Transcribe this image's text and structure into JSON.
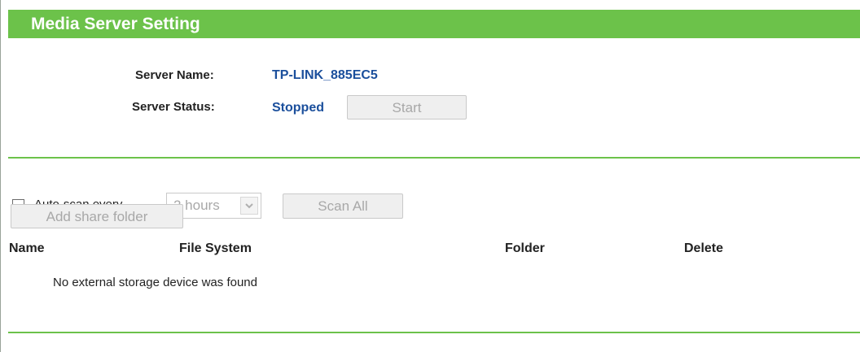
{
  "header": {
    "title": "Media Server Setting"
  },
  "server": {
    "name_label": "Server Name:",
    "name_value": "TP-LINK_885EC5",
    "status_label": "Server Status:",
    "status_value": "Stopped",
    "start_button": "Start"
  },
  "scan": {
    "auto_scan_label": "Auto-scan every",
    "interval_selected": "2 hours",
    "scan_all_button": "Scan All",
    "add_folder_button": "Add share folder"
  },
  "table": {
    "columns": [
      "Name",
      "File System",
      "Folder",
      "Delete"
    ],
    "empty_message": "No external storage device was found"
  },
  "colors": {
    "header_green": "#6cc24a",
    "value_blue": "#1b4f9c",
    "disabled_text": "#a8a8a8"
  }
}
